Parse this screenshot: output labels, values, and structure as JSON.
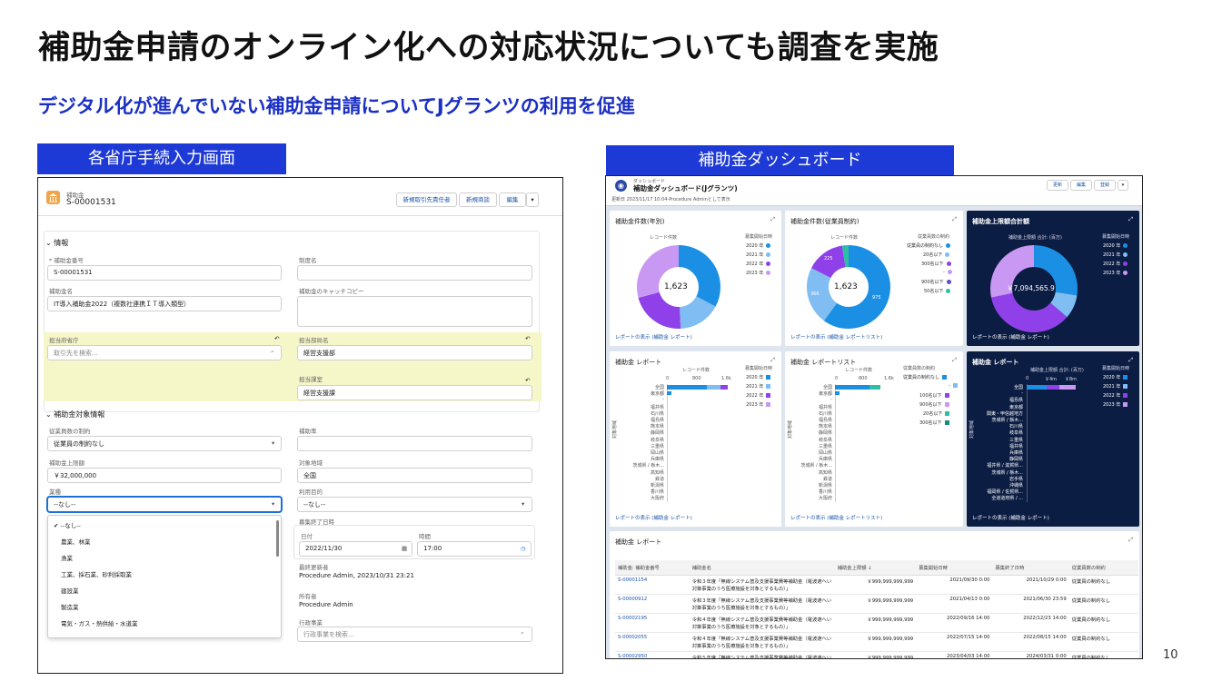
{
  "slide": {
    "title": "補助金申請のオンライン化への対応状況についても調査を実施",
    "subtitle": "デジタル化が進んでいない補助金申請についてJグランツの利用を促進",
    "left_label": "各省庁手続入力画面",
    "right_label": "補助金ダッシュボード",
    "page_number": "10"
  },
  "form": {
    "object_type": "補助金",
    "record_name": "S-00001531",
    "buttons": [
      "新規取引先責任者",
      "新規商談",
      "編集"
    ],
    "section_info": "情報",
    "fields": {
      "subsidy_no_label": "* 補助金番号",
      "subsidy_no_value": "S-00001531",
      "system_name_label": "制度名",
      "subsidy_name_label": "補助金名",
      "subsidy_name_value": "IT導入補助金2022（複数社連携ＩＴ導入類型）",
      "catchcopy_label": "補助金のキャッチコピー",
      "ministry_label": "担当府省庁",
      "ministry_placeholder": "取引先を検索...",
      "dept_label": "担当部局名",
      "dept_value": "経営支援部",
      "section_label": "担当課室",
      "section_value": "経営支援課"
    },
    "section_target": "補助金対象情報",
    "target": {
      "employee_label": "従業員数の制約",
      "employee_value": "従業員の制約なし",
      "rate_label": "補助率",
      "maxamount_label": "補助金上限額",
      "maxamount_value": "￥32,000,000",
      "region_label": "対象地域",
      "region_value": "全国",
      "industry_label": "業種",
      "industry_value": "--なし--",
      "purpose_label": "利用目的",
      "purpose_value": "--なし--",
      "end_label": "募集終了日時",
      "date_label": "日付",
      "date_value": "2022/11/30",
      "time_label": "時間",
      "time_value": "17:00",
      "modified_label": "最終更新者",
      "modified_value": "Procedure Admin, 2023/10/31 23:21",
      "owner_label": "所有者",
      "owner_value": "Procedure Admin",
      "admin_label": "行政事業",
      "admin_placeholder": "行政事業を検索..."
    },
    "industry_options": [
      "--なし--",
      "農業、林業",
      "漁業",
      "工業、採石業、砂利採取業",
      "建設業",
      "製造業",
      "電気・ガス・熱供給・水道業"
    ]
  },
  "dashboard": {
    "breadcrumb": "ダッシュボード",
    "title": "補助金ダッシュボード(Jグランツ)",
    "updated": "更新日 2023/11/17 10:04-Procedure Adminとして表示",
    "buttons": [
      "更新",
      "編集",
      "登録"
    ],
    "cards": {
      "c1": {
        "title": "補助金件数(年別)",
        "center": "1,623",
        "axis": "レコード件数",
        "legend_title": "募集開始日時",
        "legend": [
          "2020 年",
          "2021 年",
          "2022 年",
          "2023 年"
        ],
        "link": "レポートの表示 (補助金 レポート)"
      },
      "c2": {
        "title": "補助金件数(従業員制約)",
        "center": "1,623",
        "axis": "レコード件数",
        "legend_title": "従業員数の制約",
        "legend": [
          "従業員の制約なし",
          "20名以下",
          "300名以下",
          "-",
          "900名以下",
          "50名以下"
        ],
        "link": "レポートの表示 (補助金 レポートリスト)",
        "labels": [
          "225",
          "366",
          "975"
        ]
      },
      "c3": {
        "title": "補助金上限額合計額",
        "center": "￥7,094,565.9",
        "axis": "補助金上限額 合計: (百万)",
        "legend_title": "募集開始日時",
        "legend": [
          "2020 年",
          "2021 年",
          "2022 年",
          "2023 年"
        ],
        "link": "レポートの表示 (補助金 レポート)"
      },
      "c4": {
        "title": "補助金 レポート",
        "axis": "レコード件数",
        "ticks": [
          "0",
          "800",
          "1.6k"
        ],
        "legend_title": "募集開始日時",
        "legend": [
          "2020 年",
          "2021 年",
          "2022 年",
          "2023 年"
        ],
        "ylabel": "対象地域",
        "prefs": [
          "全国",
          "東京都",
          "-",
          "福井県",
          "石川県",
          "福島県",
          "熊本県",
          "静岡県",
          "岐阜県",
          "三重県",
          "岡山県",
          "兵庫県",
          "茨城県 / 栃木...",
          "高知県",
          "鉄道",
          "新潟県",
          "香川県",
          "大阪府"
        ],
        "link": "レポートの表示 (補助金 レポート)"
      },
      "c5": {
        "title": "補助金 レポートリスト",
        "axis": "レコード件数",
        "ticks": [
          "0",
          "800",
          "1.6k"
        ],
        "legend_title": "従業員数の制約",
        "legend": [
          "従業員の制約なし",
          "-",
          "100名以下",
          "900名以下",
          "20名以下",
          "300名以下"
        ],
        "ylabel": "対象地域",
        "prefs": [
          "全国",
          "東京都",
          "-",
          "福井県",
          "石川県",
          "福島県",
          "熊本県",
          "静岡県",
          "岐阜県",
          "三重県",
          "岡山県",
          "兵庫県",
          "茨城県 / 栃木...",
          "高知県",
          "鉄道",
          "新潟県",
          "香川県",
          "大阪府"
        ],
        "link": "レポートの表示 (補助金 レポートリスト)"
      },
      "c6": {
        "title": "補助金 レポート",
        "axis": "補助金上限額 合計: (百万)",
        "ticks": [
          "0",
          "￥4m",
          "￥8m"
        ],
        "legend_title": "募集開始日時",
        "legend": [
          "2020 年",
          "2021 年",
          "2022 年",
          "2023 年"
        ],
        "ylabel": "対象地域",
        "prefs": [
          "全国",
          "-",
          "福島県",
          "東京都",
          "関東・甲信越地方",
          "茨城県 / 栃木...",
          "石川県",
          "岐阜県",
          "三重県",
          "福井県",
          "兵庫県",
          "静岡県",
          "福井県 / 滋賀県...",
          "茨城県 / 栃木...",
          "岩手県",
          "沖縄県",
          "福岡県 / 佐賀県...",
          "全道道府県 / ..."
        ],
        "link": "レポートの表示 (補助金 レポート)"
      }
    },
    "table": {
      "title": "補助金 レポート",
      "columns": [
        "補助金: 補助金番号",
        "補助金名",
        "補助金上限額 ↓",
        "募集開始日時",
        "募集終了日時",
        "従業員数の制約"
      ],
      "rows": [
        [
          "S-00001154",
          "令和３年度「無線システム普及支援事業費等補助金（電波遮へい対策事業のうち医療施設を対象とするもの）」",
          "￥999,999,999,999",
          "2021/09/30 0:00",
          "2021/10/29 0:00",
          "従業員の制約なし"
        ],
        [
          "S-00000912",
          "令和３年度「無線システム普及支援事業費等補助金（電波遮へい対策事業のうち医療施設を対象とするもの）」",
          "￥999,999,999,999",
          "2021/04/13 0:00",
          "2021/06/30 23:59",
          "従業員の制約なし"
        ],
        [
          "S-00002195",
          "令和４年度「無線システム普及支援事業費等補助金（電波遮へい対策事業のうち医療施設を対象とするもの）」",
          "￥999,999,999,999",
          "2022/09/16 14:00",
          "2022/12/23 14:00",
          "従業員の制約なし"
        ],
        [
          "S-00002055",
          "令和４年度「無線システム普及支援事業費等補助金（電波遮へい対策事業のうち医療施設を対象とするもの）」",
          "￥999,999,999,999",
          "2022/07/15 14:00",
          "2022/08/15 14:00",
          "従業員の制約なし"
        ],
        [
          "S-00002950",
          "令和５年度「無線システム普及支援事業費等補助金（電波遮へい対策事業のうち医療施設を対象とするもの）」",
          "￥999,999,999,999",
          "2023/04/03 14:00",
          "2024/03/31 0:00",
          "従業員の制約なし"
        ]
      ]
    },
    "colors": {
      "y2020": "#1b8fe3",
      "y2021": "#7fbdf3",
      "y2022": "#8f40e8",
      "y2023": "#c898f2",
      "teal": "#2bbfa5",
      "navy": "#0c1d44"
    }
  }
}
